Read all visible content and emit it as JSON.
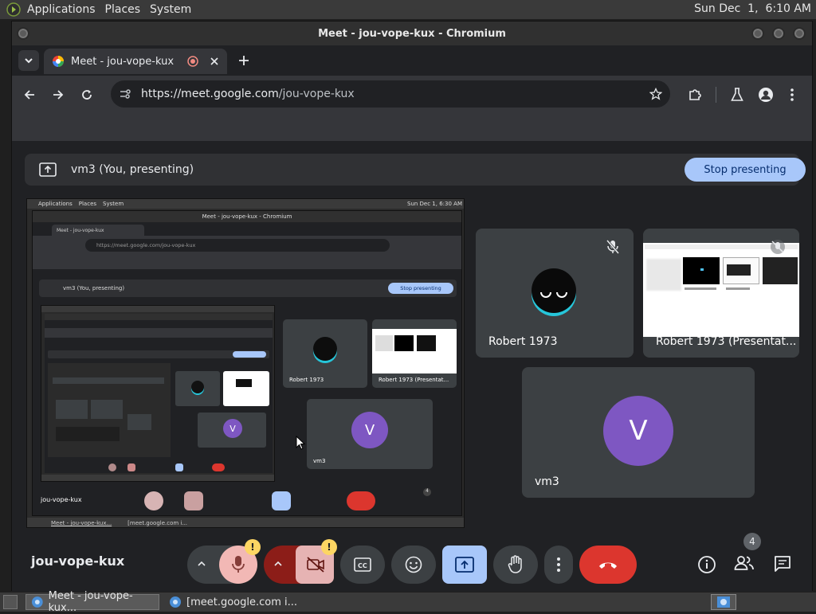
{
  "topbar": {
    "menus": [
      "Applications",
      "Places",
      "System"
    ],
    "clock": "Sun Dec  1,  6:10 AM"
  },
  "window": {
    "title": "Meet - jou-vope-kux - Chromium"
  },
  "browser": {
    "tab_title": "Meet - jou-vope-kux",
    "url_host": "https://meet.google.com",
    "url_path": "/jou-vope-kux"
  },
  "meet": {
    "banner_text": "vm3 (You, presenting)",
    "stop_presenting": "Stop presenting",
    "meeting_code": "jou-vope-kux",
    "participants_count": "4",
    "tiles": [
      {
        "name": "Robert 1973",
        "muted": true
      },
      {
        "name": "Robert 1973 (Presentat...",
        "muted": true
      },
      {
        "name": "vm3",
        "initial": "V"
      }
    ],
    "nested": {
      "topbar_menus": [
        "Applications",
        "Places",
        "System"
      ],
      "clock": "Sun Dec 1, 6:30 AM",
      "window_title": "Meet - jou-vope-kux - Chromium",
      "tab_title": "Meet - jou-vope-kux",
      "url": "https://meet.google.com/jou-vope-kux",
      "banner_text": "vm3 (You, presenting)",
      "stop_presenting": "Stop presenting",
      "tile_robert": "Robert 1973",
      "tile_robert_presentation": "Robert 1973 (Presentat...",
      "tile_vm3": "vm3",
      "initial": "V",
      "meeting_code": "jou-vope-kux",
      "participants_count": "4",
      "taskbar_task1": "Meet - jou-vope-kux...",
      "taskbar_task2": "[meet.google.com i..."
    }
  },
  "taskbar": {
    "task1": "Meet - jou-vope-kux...",
    "task2": "[meet.google.com i..."
  },
  "colors": {
    "accent_blue": "#a8c7fa",
    "leave_red": "#dc362e",
    "warning_yellow": "#fdd663",
    "avatar_purple": "#7e57c2",
    "tile_bg": "#3c4043"
  }
}
